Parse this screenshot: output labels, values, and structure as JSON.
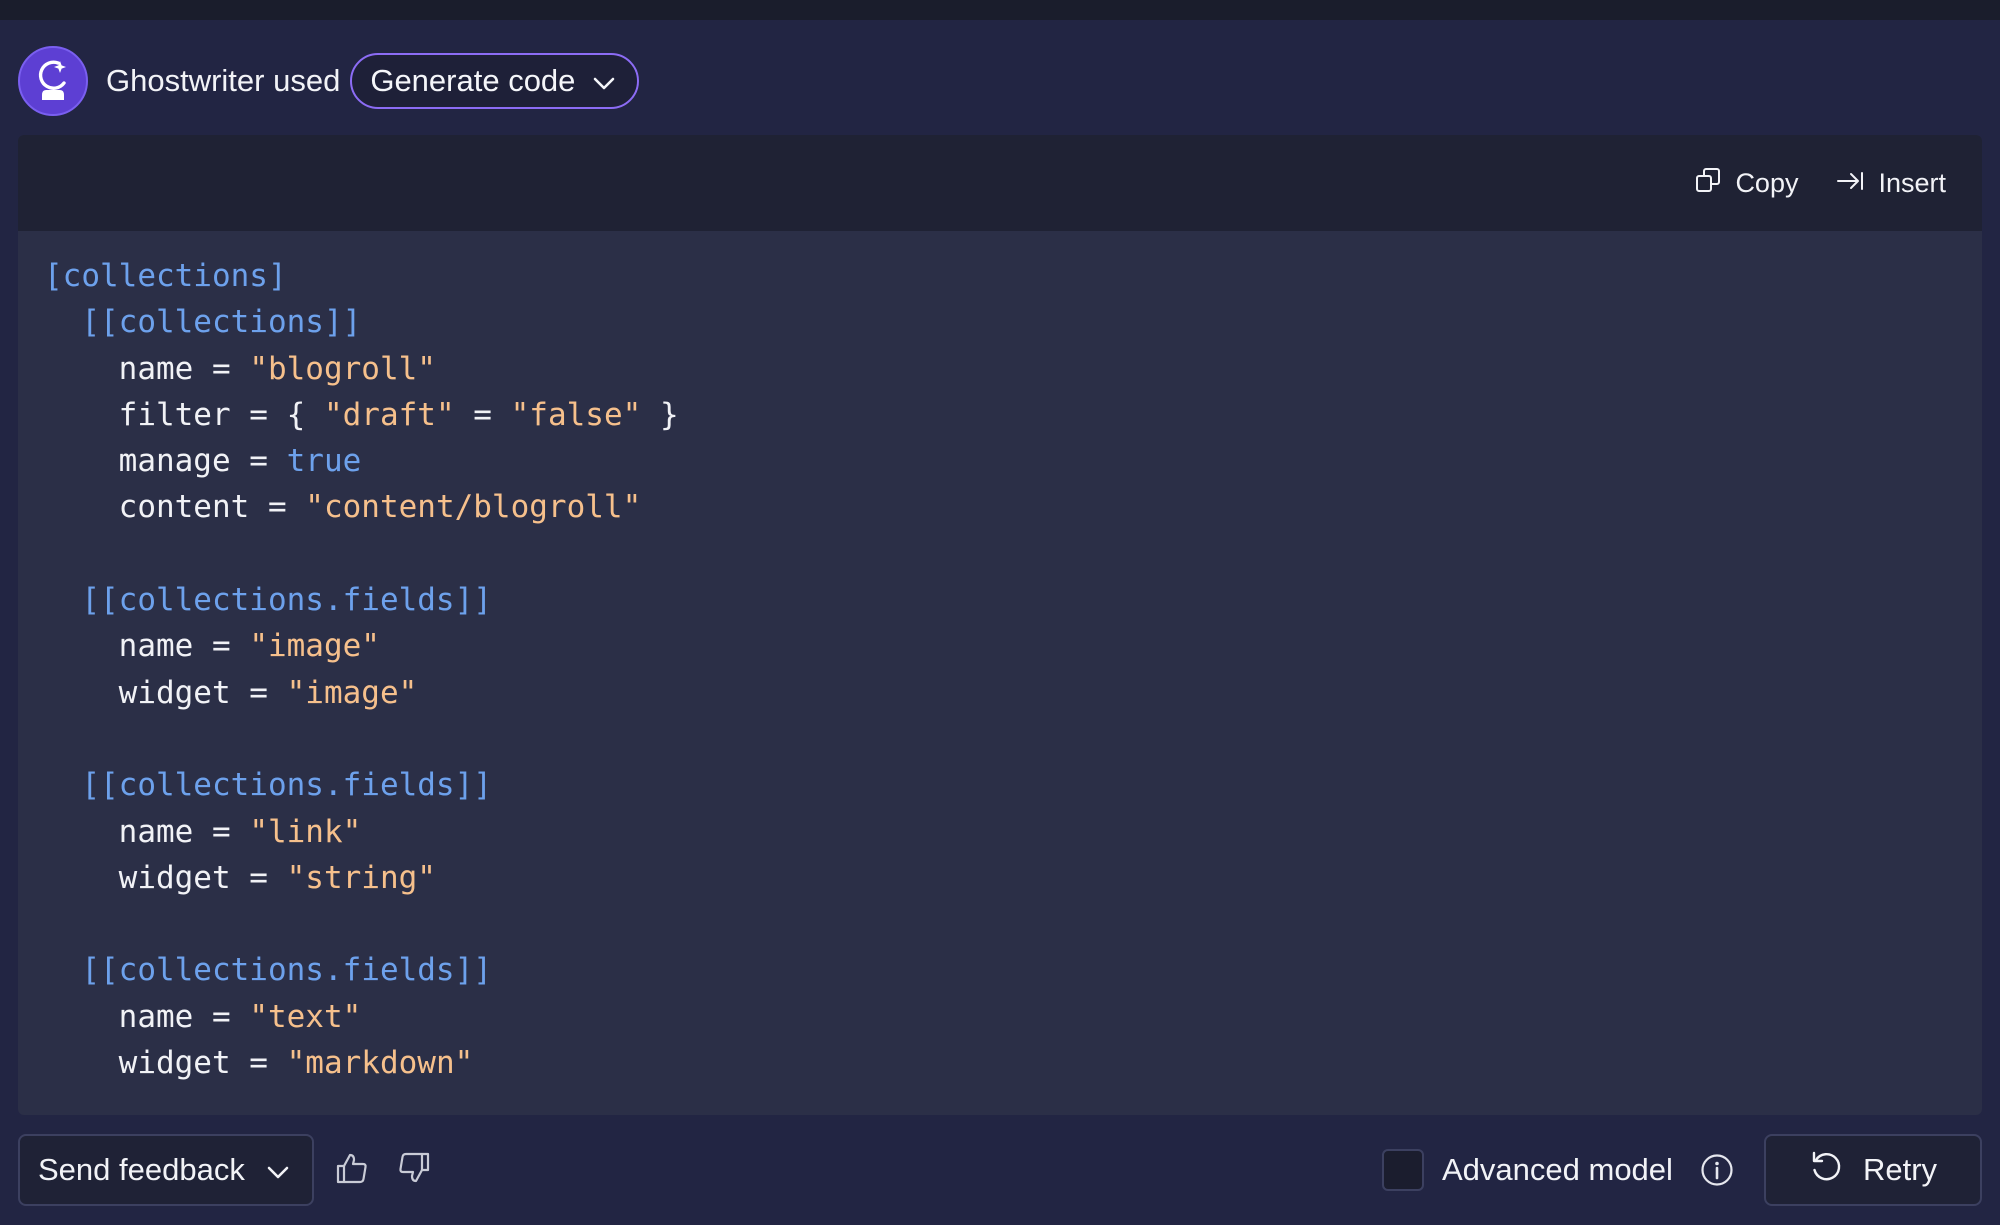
{
  "header": {
    "used_label": "Ghostwriter used",
    "tool_label": "Generate code",
    "avatar_icon": "ghostwriter-icon",
    "accent": "#5d3fd3"
  },
  "code_panel": {
    "copy_label": "Copy",
    "insert_label": "Insert",
    "lines": [
      [
        {
          "t": "[collections]",
          "c": "header"
        }
      ],
      [
        {
          "t": "  [[collections]]",
          "c": "header"
        }
      ],
      [
        {
          "t": "    name = ",
          "c": "key"
        },
        {
          "t": "\"blogroll\"",
          "c": "str"
        }
      ],
      [
        {
          "t": "    filter = { ",
          "c": "key"
        },
        {
          "t": "\"draft\"",
          "c": "str"
        },
        {
          "t": " = ",
          "c": "key"
        },
        {
          "t": "\"false\"",
          "c": "str"
        },
        {
          "t": " }",
          "c": "key"
        }
      ],
      [
        {
          "t": "    manage = ",
          "c": "key"
        },
        {
          "t": "true",
          "c": "bool"
        }
      ],
      [
        {
          "t": "    content = ",
          "c": "key"
        },
        {
          "t": "\"content/blogroll\"",
          "c": "str"
        }
      ],
      [],
      [
        {
          "t": "  [[collections.fields]]",
          "c": "header"
        }
      ],
      [
        {
          "t": "    name = ",
          "c": "key"
        },
        {
          "t": "\"image\"",
          "c": "str"
        }
      ],
      [
        {
          "t": "    widget = ",
          "c": "key"
        },
        {
          "t": "\"image\"",
          "c": "str"
        }
      ],
      [],
      [
        {
          "t": "  [[collections.fields]]",
          "c": "header"
        }
      ],
      [
        {
          "t": "    name = ",
          "c": "key"
        },
        {
          "t": "\"link\"",
          "c": "str"
        }
      ],
      [
        {
          "t": "    widget = ",
          "c": "key"
        },
        {
          "t": "\"string\"",
          "c": "str"
        }
      ],
      [],
      [
        {
          "t": "  [[collections.fields]]",
          "c": "header"
        }
      ],
      [
        {
          "t": "    name = ",
          "c": "key"
        },
        {
          "t": "\"text\"",
          "c": "str"
        }
      ],
      [
        {
          "t": "    widget = ",
          "c": "key"
        },
        {
          "t": "\"markdown\"",
          "c": "str"
        }
      ]
    ]
  },
  "footer": {
    "feedback_label": "Send feedback",
    "advanced_label": "Advanced model",
    "advanced_checked": false,
    "retry_label": "Retry"
  }
}
